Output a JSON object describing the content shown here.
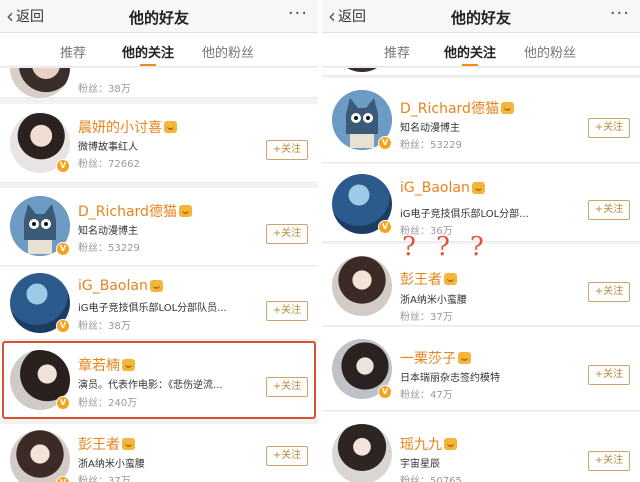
{
  "left": {
    "nav": {
      "back_label": "返回",
      "title": "他的好友",
      "more_label": "···"
    },
    "tabs": [
      "推荐",
      "他的关注",
      "他的粉丝"
    ],
    "users": [
      {
        "name": "",
        "desc": "",
        "fans": "粉丝：38万"
      },
      {
        "name": "晨妍的小讨喜",
        "desc": "微博故事红人",
        "fans": "粉丝：72662"
      },
      {
        "name": "D_Richard德猫",
        "desc": "知名动漫博主",
        "fans": "粉丝：53229"
      },
      {
        "name": "iG_Baolan",
        "desc": "iG电子竞技俱乐部LOL分部队员...",
        "fans": "粉丝：38万"
      },
      {
        "name": "章若楠",
        "desc": "演员。代表作电影：《悲伤逆流...",
        "fans": "粉丝：240万"
      },
      {
        "name": "彭王者",
        "desc": "浙A纳米小蛮腰",
        "fans": "粉丝：37万"
      }
    ],
    "follow_label": "+关注"
  },
  "right": {
    "nav": {
      "back_label": "返回",
      "title": "他的好友",
      "more_label": "···"
    },
    "tabs": [
      "推荐",
      "他的关注",
      "他的粉丝"
    ],
    "users": [
      {
        "name": "D_Richard德猫",
        "desc": "知名动漫博主",
        "fans": "粉丝：53229"
      },
      {
        "name": "iG_Baolan",
        "desc": "iG电子竞技俱乐部LOL分部...",
        "fans": "粉丝：36万"
      },
      {
        "name": "彭王者",
        "desc": "浙A纳米小蛮腰",
        "fans": "粉丝：37万"
      },
      {
        "name": "一栗莎子",
        "desc": "日本瑞丽杂志签约模特",
        "fans": "粉丝：47万"
      },
      {
        "name": "瑶九九",
        "desc": "宇宙星辰",
        "fans": "粉丝：50765"
      }
    ],
    "follow_label": "+关注"
  },
  "annotation": {
    "question_marks": [
      "?",
      "?",
      "?"
    ],
    "color": "#e0533a"
  },
  "colors": {
    "accent": "#f28b1c",
    "name": "#e8831c",
    "highlight": "#d9502f",
    "verified": "#f6a21e"
  }
}
